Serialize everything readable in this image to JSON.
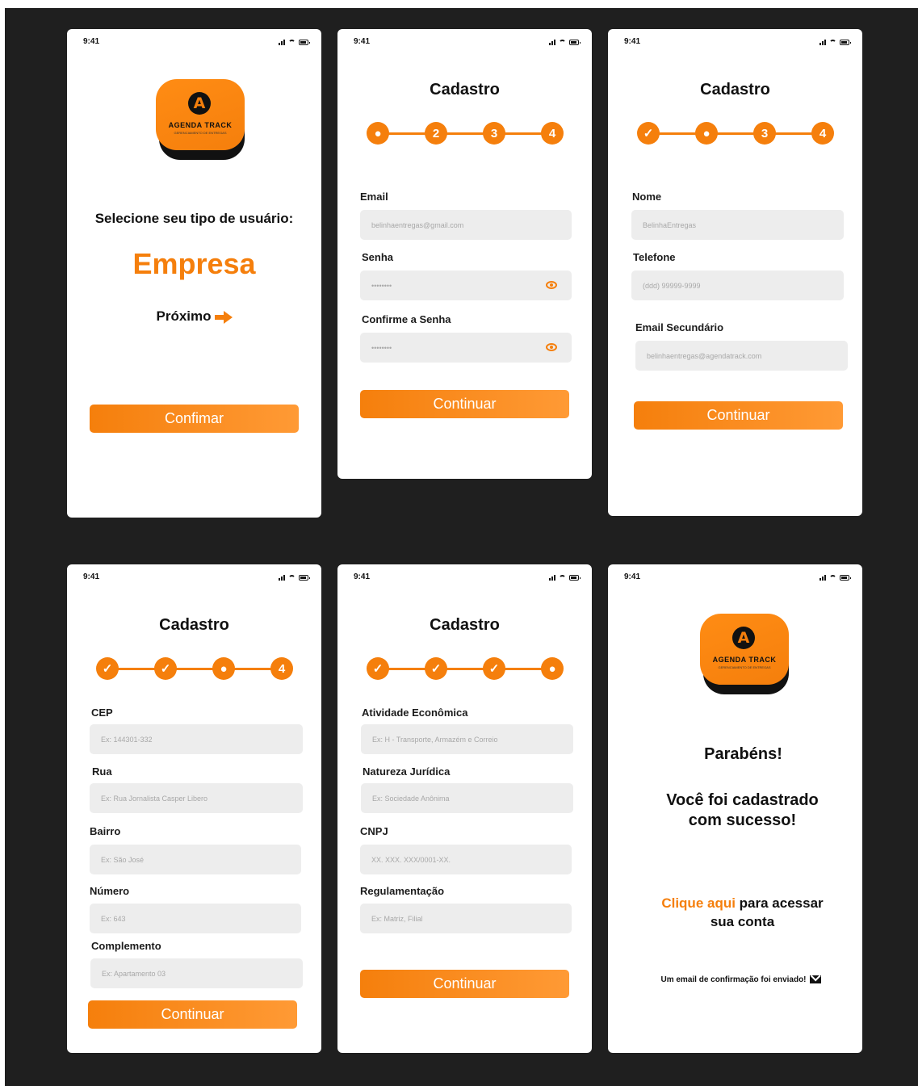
{
  "colors": {
    "accent": "#f57f0c",
    "background": "#1f1f1f",
    "field": "#ededed"
  },
  "status_time": "9:41",
  "logo": {
    "brand": "AGENDA TRACK",
    "letter": "A",
    "sub": "GERENCIAMENTO DE ENTREGAS"
  },
  "s1": {
    "heading": "Selecione seu tipo de usuário:",
    "type": "Empresa",
    "next": "Próximo",
    "confirm": "Confimar"
  },
  "cadastro_title": "Cadastro",
  "s2": {
    "steps": [
      "",
      "2",
      "3",
      "4"
    ],
    "email_label": "Email",
    "email_value": "belinhaentregas@gmail.com",
    "senha_label": "Senha",
    "senha_value": "••••••••",
    "confirme_label": "Confirme a Senha",
    "confirme_value": "••••••••",
    "button": "Continuar"
  },
  "s3": {
    "steps": [
      "✓",
      "",
      "3",
      "4"
    ],
    "nome_label": "Nome",
    "nome_value": "BelinhaEntregas",
    "telefone_label": "Telefone",
    "telefone_value": "(ddd) 99999-9999",
    "email2_label": "Email Secundário",
    "email2_value": "belinhaentregas@agendatrack.com",
    "button": "Continuar"
  },
  "s4": {
    "steps": [
      "✓",
      "✓",
      "",
      "4"
    ],
    "cep_label": "CEP",
    "cep_value": "Ex: 144301-332",
    "rua_label": "Rua",
    "rua_value": "Ex: Rua Jornalista Casper Libero",
    "bairro_label": "Bairro",
    "bairro_value": "Ex: São José",
    "numero_label": "Número",
    "numero_value": "Ex: 643",
    "complemento_label": "Complemento",
    "complemento_value": "Ex: Apartamento 03",
    "button": "Continuar"
  },
  "s5": {
    "steps": [
      "✓",
      "✓",
      "✓",
      ""
    ],
    "atividade_label": "Atividade Econômica",
    "atividade_value": "Ex: H - Transporte, Armazém e Correio",
    "natureza_label": "Natureza Jurídica",
    "natureza_value": "Ex: Sociedade Anônima",
    "cnpj_label": "CNPJ",
    "cnpj_value": "XX. XXX. XXX/0001-XX.",
    "regulamentacao_label": "Regulamentação",
    "regulamentacao_value": "Ex: Matriz, Filial",
    "button": "Continuar"
  },
  "s6": {
    "congrats": "Parabéns!",
    "msg_line1": "Você foi cadastrado",
    "msg_line2": "com sucesso!",
    "link": "Clique aqui",
    "link_rest": " para acessar",
    "link_line2": "sua conta",
    "email_sent": "Um email de confirmação foi enviado!"
  }
}
